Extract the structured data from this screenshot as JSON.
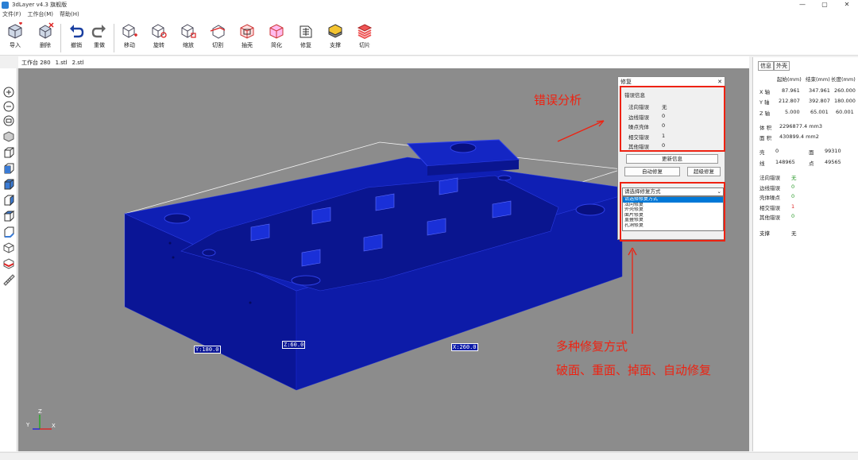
{
  "window": {
    "title": "3dLayer v4.3 旗舰版",
    "controls": [
      "—",
      "▢",
      "✕"
    ]
  },
  "menu": [
    "文件(F)",
    "工作台(M)",
    "帮助(H)"
  ],
  "toolbar": [
    {
      "label": "导入",
      "icon": "import-icon"
    },
    {
      "label": "删除",
      "icon": "delete-icon"
    },
    {
      "label": "撤销",
      "icon": "undo-icon"
    },
    {
      "label": "重做",
      "icon": "redo-icon"
    },
    {
      "label": "移动",
      "icon": "move-icon"
    },
    {
      "label": "旋转",
      "icon": "rotate-icon"
    },
    {
      "label": "缩放",
      "icon": "scale-icon"
    },
    {
      "label": "切割",
      "icon": "cut-icon"
    },
    {
      "label": "抽壳",
      "icon": "shell-icon"
    },
    {
      "label": "简化",
      "icon": "simplify-icon"
    },
    {
      "label": "修复",
      "icon": "repair-icon"
    },
    {
      "label": "支撑",
      "icon": "support-icon"
    },
    {
      "label": "切片",
      "icon": "slice-icon"
    }
  ],
  "tabs": {
    "workbench": "工作台 280",
    "file1": "1.stl",
    "file2": "2.stl"
  },
  "viewport": {
    "labels": {
      "y": "Y:180.0",
      "z": "Z:60.0",
      "x": "X:260.0"
    },
    "axis": {
      "x": "X",
      "y": "Y",
      "z": "Z"
    }
  },
  "right_panel": {
    "tabs": [
      "信息",
      "外壳"
    ],
    "headers": [
      "起始(mm)",
      "结束(mm)",
      "长度(mm)"
    ],
    "axes": [
      {
        "name": "X 轴",
        "start": "87.961",
        "end": "347.961",
        "len": "260.000"
      },
      {
        "name": "Y 轴",
        "start": "212.807",
        "end": "392.807",
        "len": "180.000"
      },
      {
        "name": "Z 轴",
        "start": "5.000",
        "end": "65.001",
        "len": "60.001"
      }
    ],
    "volume_label": "体 积",
    "volume": "2296877.4 mm3",
    "area_label": "面 积",
    "area": "430899.4 mm2",
    "shell_label": "壳",
    "shell": "0",
    "face_label": "面",
    "face": "99310",
    "line_label": "线",
    "line": "148965",
    "point_label": "点",
    "point": "49565",
    "errors": [
      {
        "label": "法向错误",
        "value": "无",
        "color": "green"
      },
      {
        "label": "边线错误",
        "value": "0",
        "color": "green"
      },
      {
        "label": "壳体噪点",
        "value": "0",
        "color": "green"
      },
      {
        "label": "相交错误",
        "value": "1",
        "color": "red"
      },
      {
        "label": "其他错误",
        "value": "0",
        "color": "green"
      }
    ],
    "support_label": "支撑",
    "support": "无"
  },
  "repair_dialog": {
    "title": "修复",
    "close": "✕",
    "section": "错误信息",
    "errors": [
      {
        "label": "法向错误",
        "value": "无",
        "color": "green"
      },
      {
        "label": "边线错误",
        "value": "0",
        "color": "green"
      },
      {
        "label": "噪点壳体",
        "value": "0",
        "color": "green"
      },
      {
        "label": "相交错误",
        "value": "1",
        "color": "red"
      },
      {
        "label": "其他错误",
        "value": "0",
        "color": "green"
      }
    ],
    "update_btn": "更新信息",
    "auto_btn": "自动修复",
    "super_btn": "超级修复",
    "select_value": "请选择修复方式",
    "options": [
      "请选择修复方式",
      "法向修复",
      "外壳修复",
      "面片修复",
      "重叠修复",
      "孔洞修复"
    ]
  },
  "annotations": {
    "error_analysis": "错误分析",
    "multi_repair": "多种修复方式",
    "repair_types": "破面、重面、掉面、自动修复"
  },
  "colors": {
    "model": "#0b1a9e",
    "accent": "#e21b1b",
    "viewport": "#8c8c8c"
  }
}
